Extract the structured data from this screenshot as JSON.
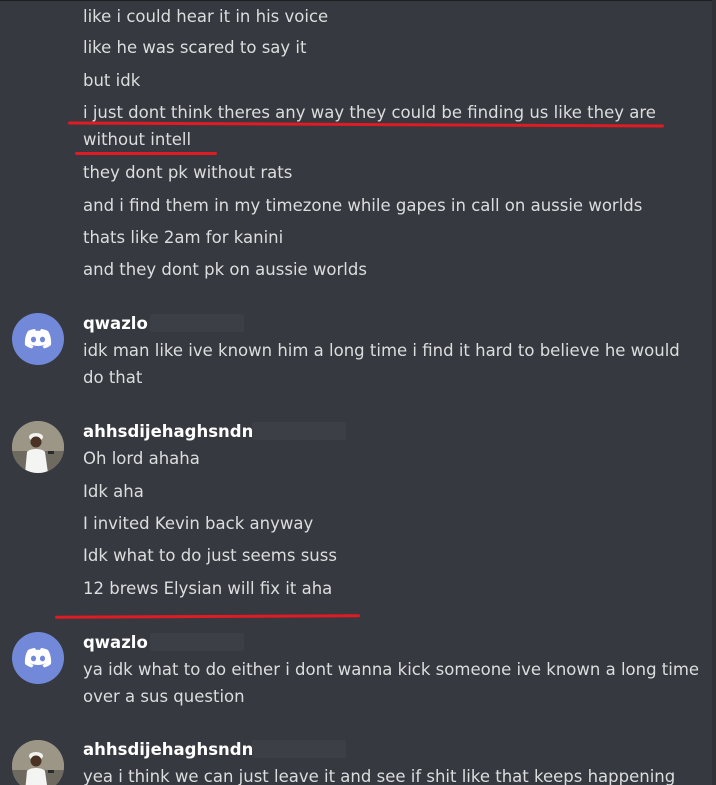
{
  "messages": {
    "continued": [
      "like i could hear it in his voice",
      "like he was scared to say it",
      "but idk",
      "i just dont think theres any way they could be finding us like they are",
      "without intell",
      "they dont pk without rats",
      "and i find them in my timezone while gapes in call on aussie worlds",
      "thats like 2am for kanini",
      "and they dont pk on aussie worlds"
    ],
    "group1": {
      "username": "qwazlo",
      "avatar_icon": "discord-logo-icon",
      "lines": [
        "idk man like ive known him a long time i find it hard to believe he would",
        "do that"
      ]
    },
    "group2": {
      "username": "ahhsdijehaghsndnd",
      "avatar_icon": "user-photo-icon",
      "lines": [
        "Oh lord ahaha",
        "Idk aha",
        "I invited Kevin back anyway",
        "Idk what to do just seems suss",
        "12 brews Elysian will fix it aha"
      ]
    },
    "group3": {
      "username": "qwazlo",
      "avatar_icon": "discord-logo-icon",
      "lines": [
        "ya idk what to do either i dont wanna kick someone ive known a long time",
        "over a sus question"
      ]
    },
    "group4": {
      "username": "ahhsdijehaghsndnd",
      "avatar_icon": "user-photo-icon",
      "lines": [
        "yea i think we can just leave it and see if shit like that keeps happening"
      ]
    }
  },
  "colors": {
    "background": "#36393f",
    "text": "#dcddde",
    "username": "#ffffff",
    "blurple": "#7289da",
    "annotation_red": "#e01b24"
  }
}
